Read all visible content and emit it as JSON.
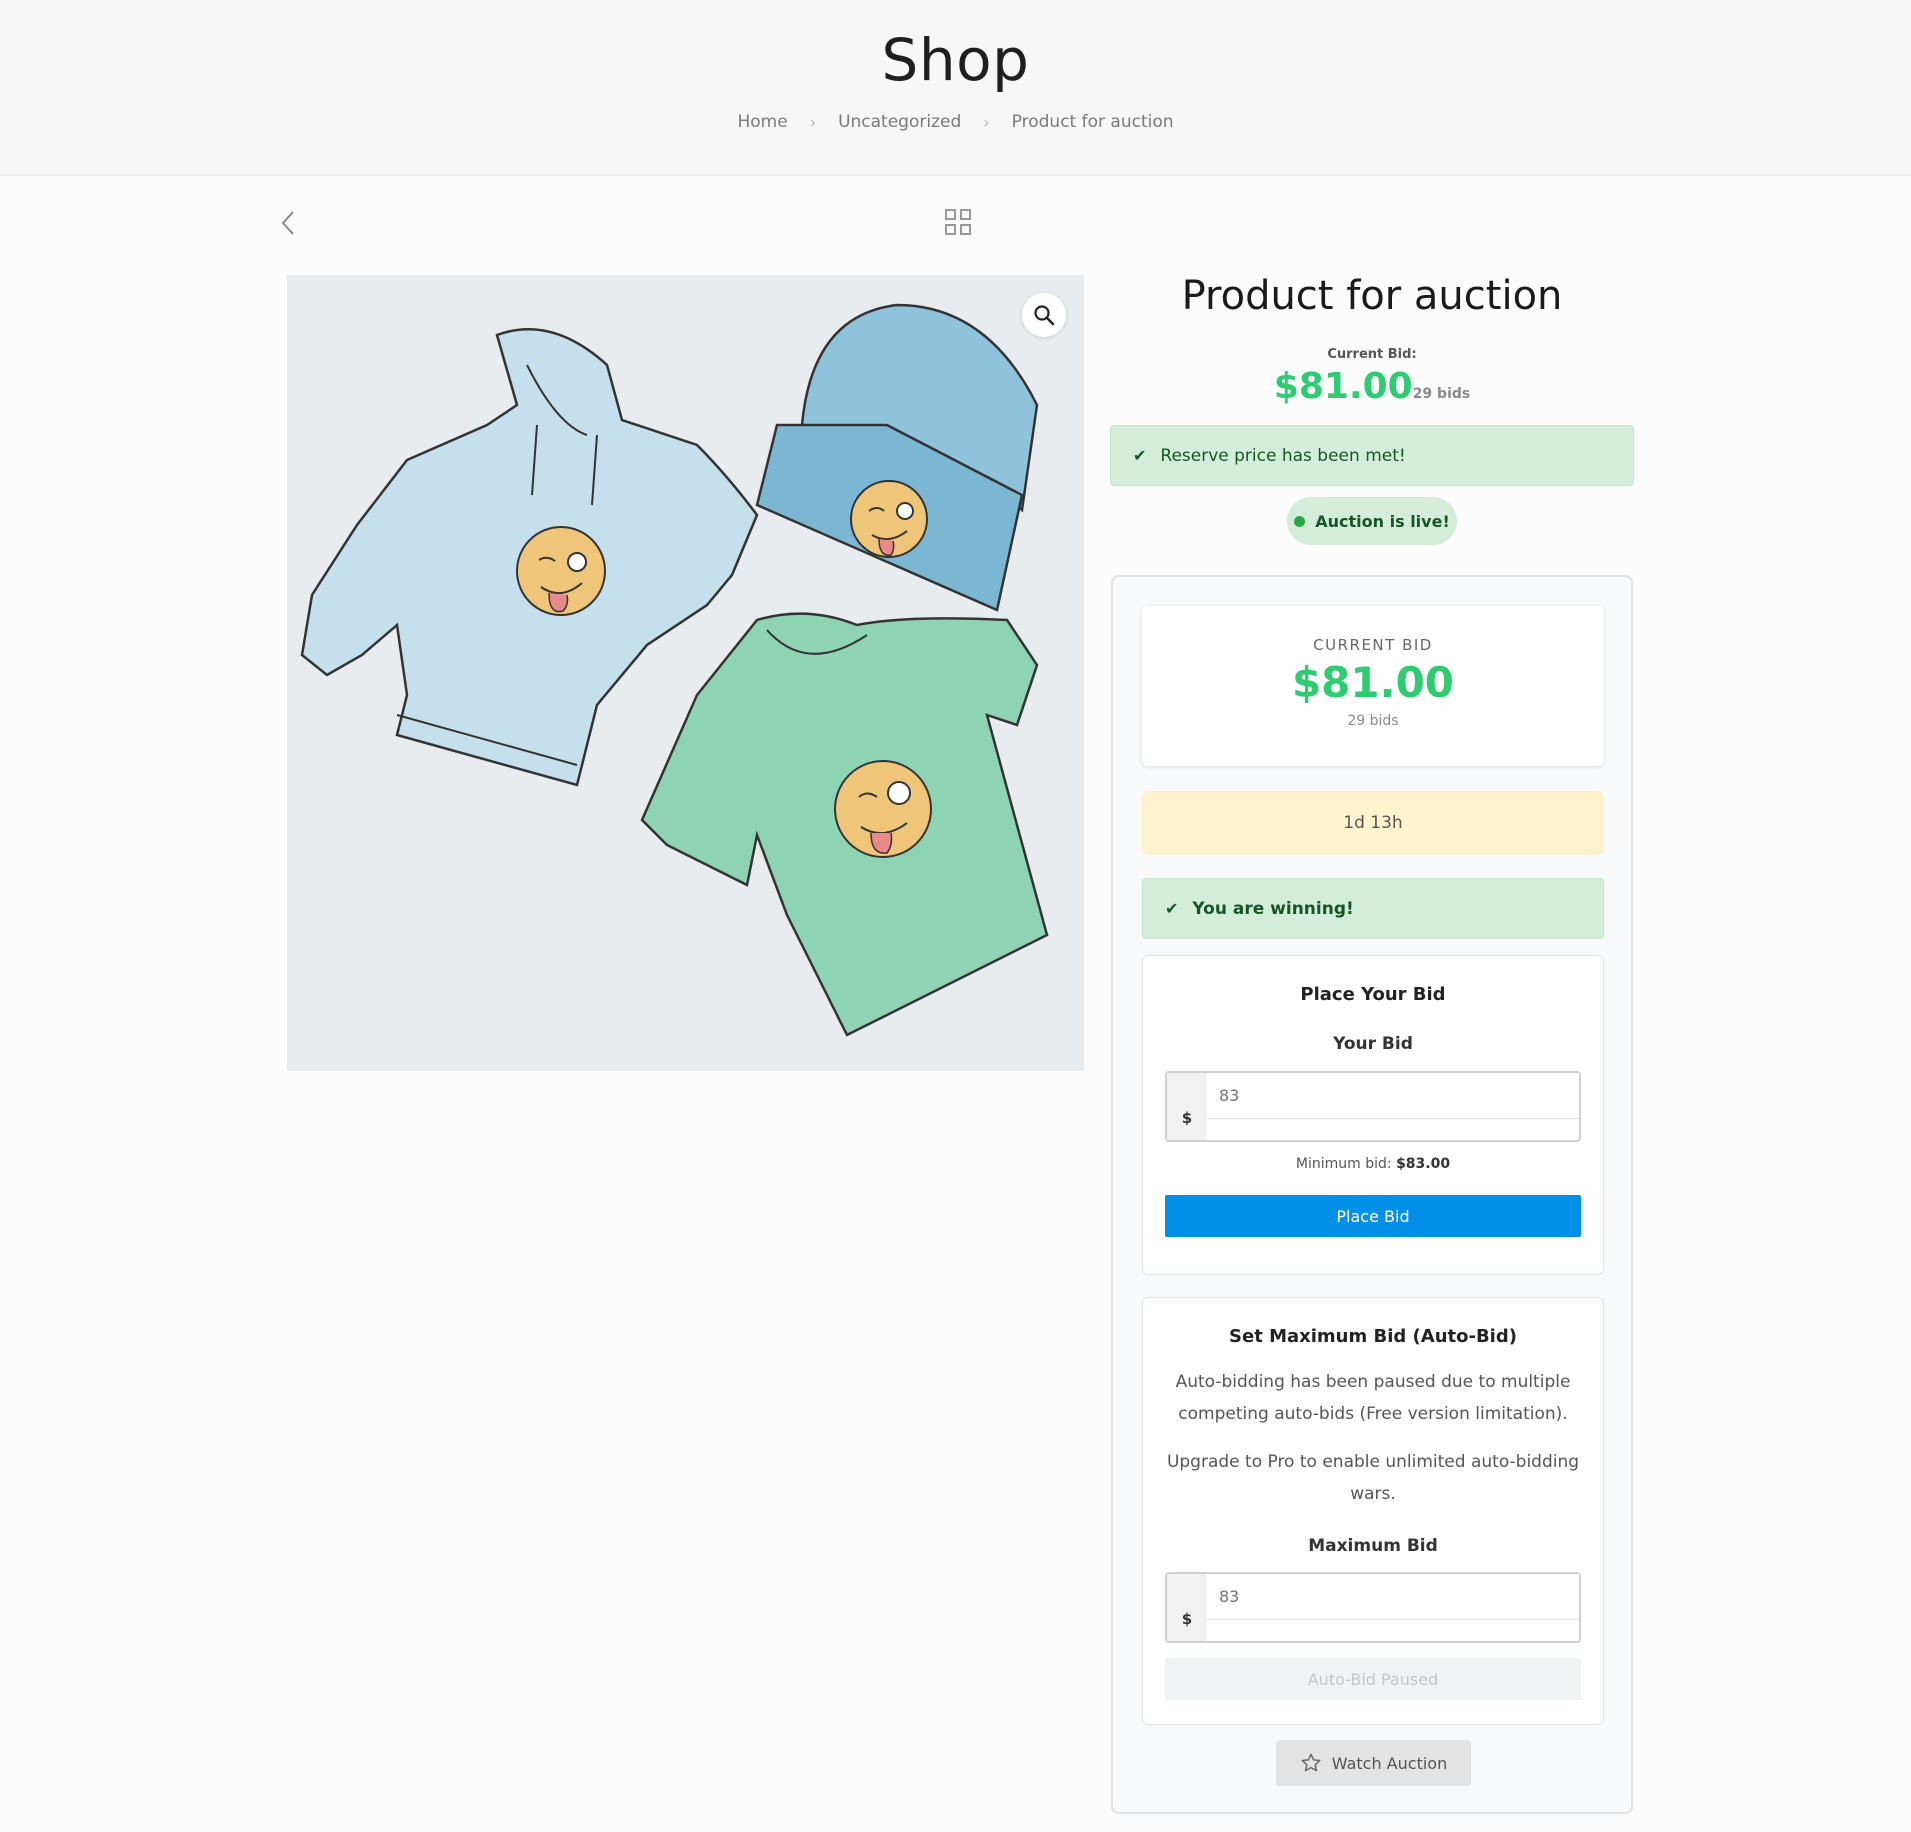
{
  "header": {
    "title": "Shop",
    "breadcrumb": [
      "Home",
      "Uncategorized",
      "Product for auction"
    ]
  },
  "nav": {
    "back_icon": "chevron-left-icon",
    "grid_icon": "grid-icon"
  },
  "product": {
    "title": "Product for auction",
    "image_icon": "zoom-icon",
    "current_bid_label": "Current Bid:",
    "current_bid_price": "$81.00",
    "current_bid_count": "29 bids"
  },
  "notices": {
    "reserve": "Reserve price has been met!",
    "live": "Auction is live!",
    "winning": "You are winning!"
  },
  "auction": {
    "card_label": "CURRENT BID",
    "card_price": "$81.00",
    "card_count": "29 bids",
    "time_left": "1d 13h"
  },
  "place_bid": {
    "title": "Place Your Bid",
    "field_label": "Your Bid",
    "currency": "$",
    "placeholder": "83",
    "min_label": "Minimum bid:",
    "min_value": "$83.00",
    "button": "Place Bid"
  },
  "max_bid": {
    "title": "Set Maximum Bid (Auto-Bid)",
    "paragraph1": "Auto-bidding has been paused due to multiple competing auto-bids (Free version limitation).",
    "paragraph2": "Upgrade to Pro to enable unlimited auto-bidding wars.",
    "field_label": "Maximum Bid",
    "currency": "$",
    "placeholder": "83",
    "button": "Auto-Bid Paused"
  },
  "watch": {
    "label": "Watch Auction",
    "icon": "star-icon"
  },
  "colors": {
    "accent_green": "#2ecc71",
    "notice_green": "#d4edda",
    "notice_yellow": "#fff3cd",
    "primary_blue": "#0090e7"
  }
}
